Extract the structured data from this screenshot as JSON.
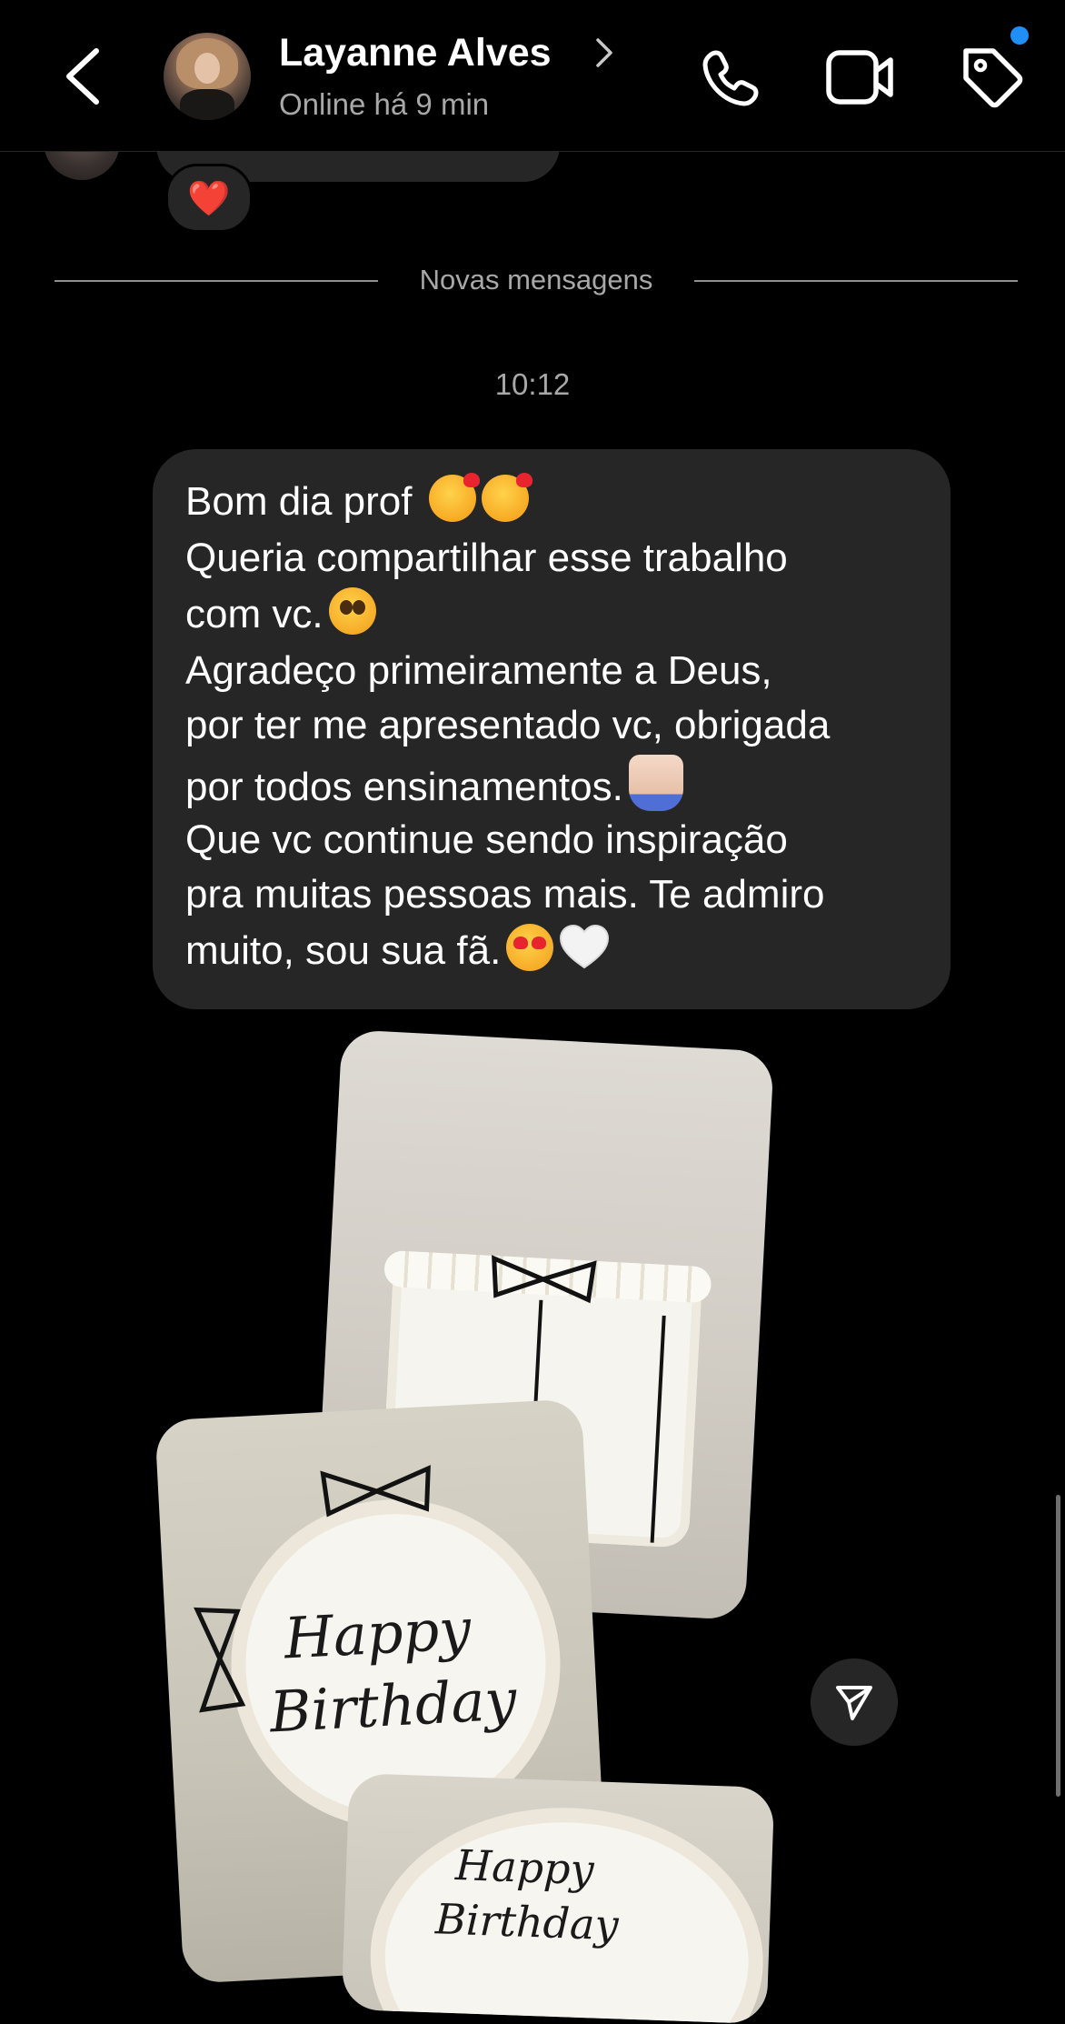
{
  "header": {
    "contact_name": "Layanne Alves",
    "status": "Online há 9 min",
    "back_icon": "chevron-left-icon",
    "call_icon": "phone-icon",
    "video_icon": "video-camera-icon",
    "tag_icon": "tag-icon",
    "has_notification": true,
    "notification_color": "#1f8ff5"
  },
  "previous_message": {
    "reaction": "❤️"
  },
  "divider": {
    "label": "Novas mensagens"
  },
  "conversation": {
    "timestamp": "10:12",
    "message_lines": [
      "Bom dia prof",
      "Queria compartilhar esse trabalho",
      "com vc.",
      "Agradeço primeiramente a Deus,",
      "por ter me apresentado vc, obrigada",
      "por todos ensinamentos.",
      "Que vc continue sendo inspiração",
      "pra muitas pessoas mais. Te admiro",
      "muito, sou sua fã."
    ],
    "emojis": {
      "line1": [
        "🥰",
        "🥰"
      ],
      "line3": [
        "🥺"
      ],
      "line6": [
        "🙏🏻"
      ],
      "line9": [
        "😍",
        "🤍"
      ]
    }
  },
  "photos": {
    "count": 3,
    "cake_text_line1": "Happy",
    "cake_text_line2": "Birthday"
  },
  "share_button": {
    "icon": "send-icon"
  },
  "colors": {
    "background": "#000000",
    "bubble": "#262626",
    "muted_text": "#a8a8a8"
  }
}
